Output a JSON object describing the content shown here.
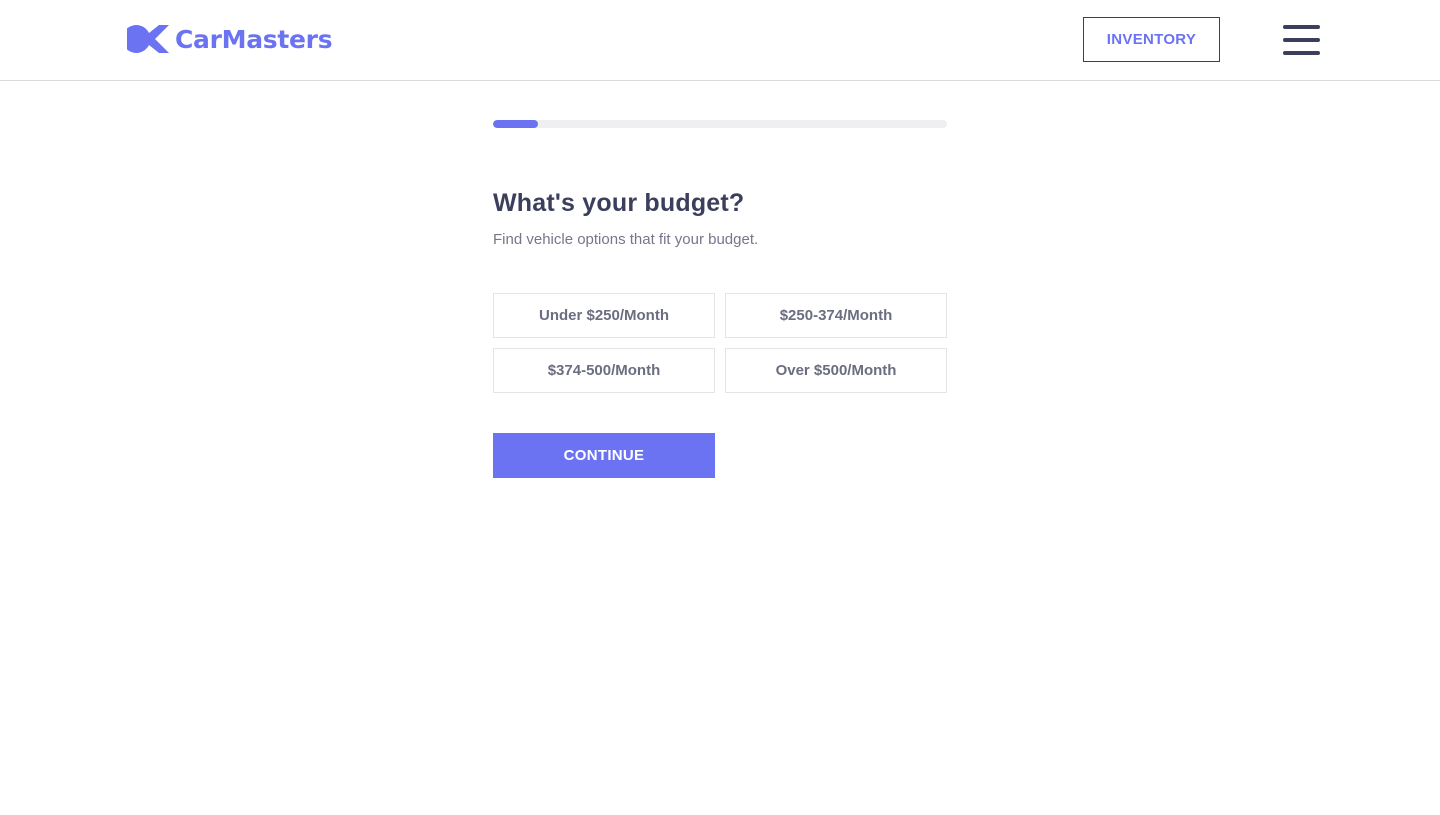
{
  "header": {
    "brand_name": "CarMasters",
    "inventory_label": "INVENTORY",
    "logo_icon": "crescent-car-logo-icon",
    "menu_icon": "hamburger-menu-icon"
  },
  "progress": {
    "fraction": 0.1
  },
  "question": {
    "title": "What's your budget?",
    "subtitle": "Find vehicle options that fit your budget."
  },
  "options": [
    {
      "label": "Under $250/Month"
    },
    {
      "label": "$250-374/Month"
    },
    {
      "label": "$374-500/Month"
    },
    {
      "label": "Over $500/Month"
    }
  ],
  "continue_label": "CONTINUE",
  "colors": {
    "accent": "#6b73f2",
    "text_dark": "#3b3f5c",
    "text_muted": "#75778a",
    "track": "#efeff1"
  }
}
